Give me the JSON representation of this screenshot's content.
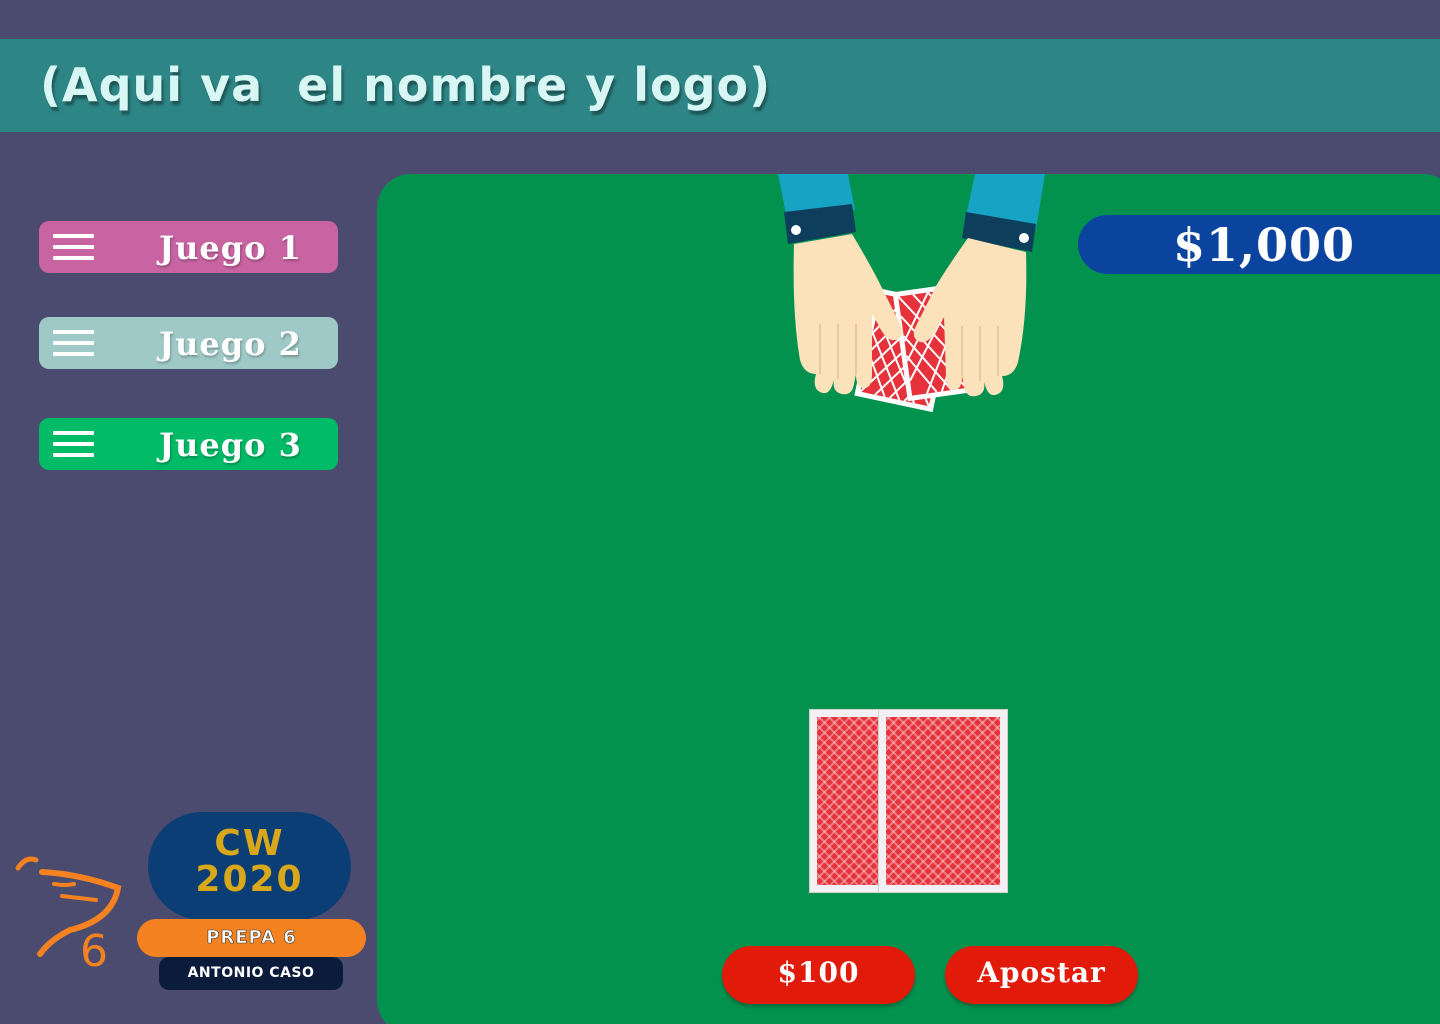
{
  "header": {
    "title": "(Aqui va  el nombre y logo)"
  },
  "sidebar": {
    "items": [
      {
        "label": "Juego 1",
        "color": "#c864a2"
      },
      {
        "label": "Juego 2",
        "color": "#9fc9c7"
      },
      {
        "label": "Juego 3",
        "color": "#02bb67"
      }
    ]
  },
  "game": {
    "balance": "$1,000",
    "bet_amount_label": "$100",
    "bet_button_label": "Apostar",
    "table_color": "#02924e"
  },
  "branding": {
    "cw_line1": "CW",
    "cw_line2": "2020",
    "school": "PREPA 6",
    "school_name": "ANTONIO CASO",
    "number": "6",
    "accent": "#f58220"
  }
}
